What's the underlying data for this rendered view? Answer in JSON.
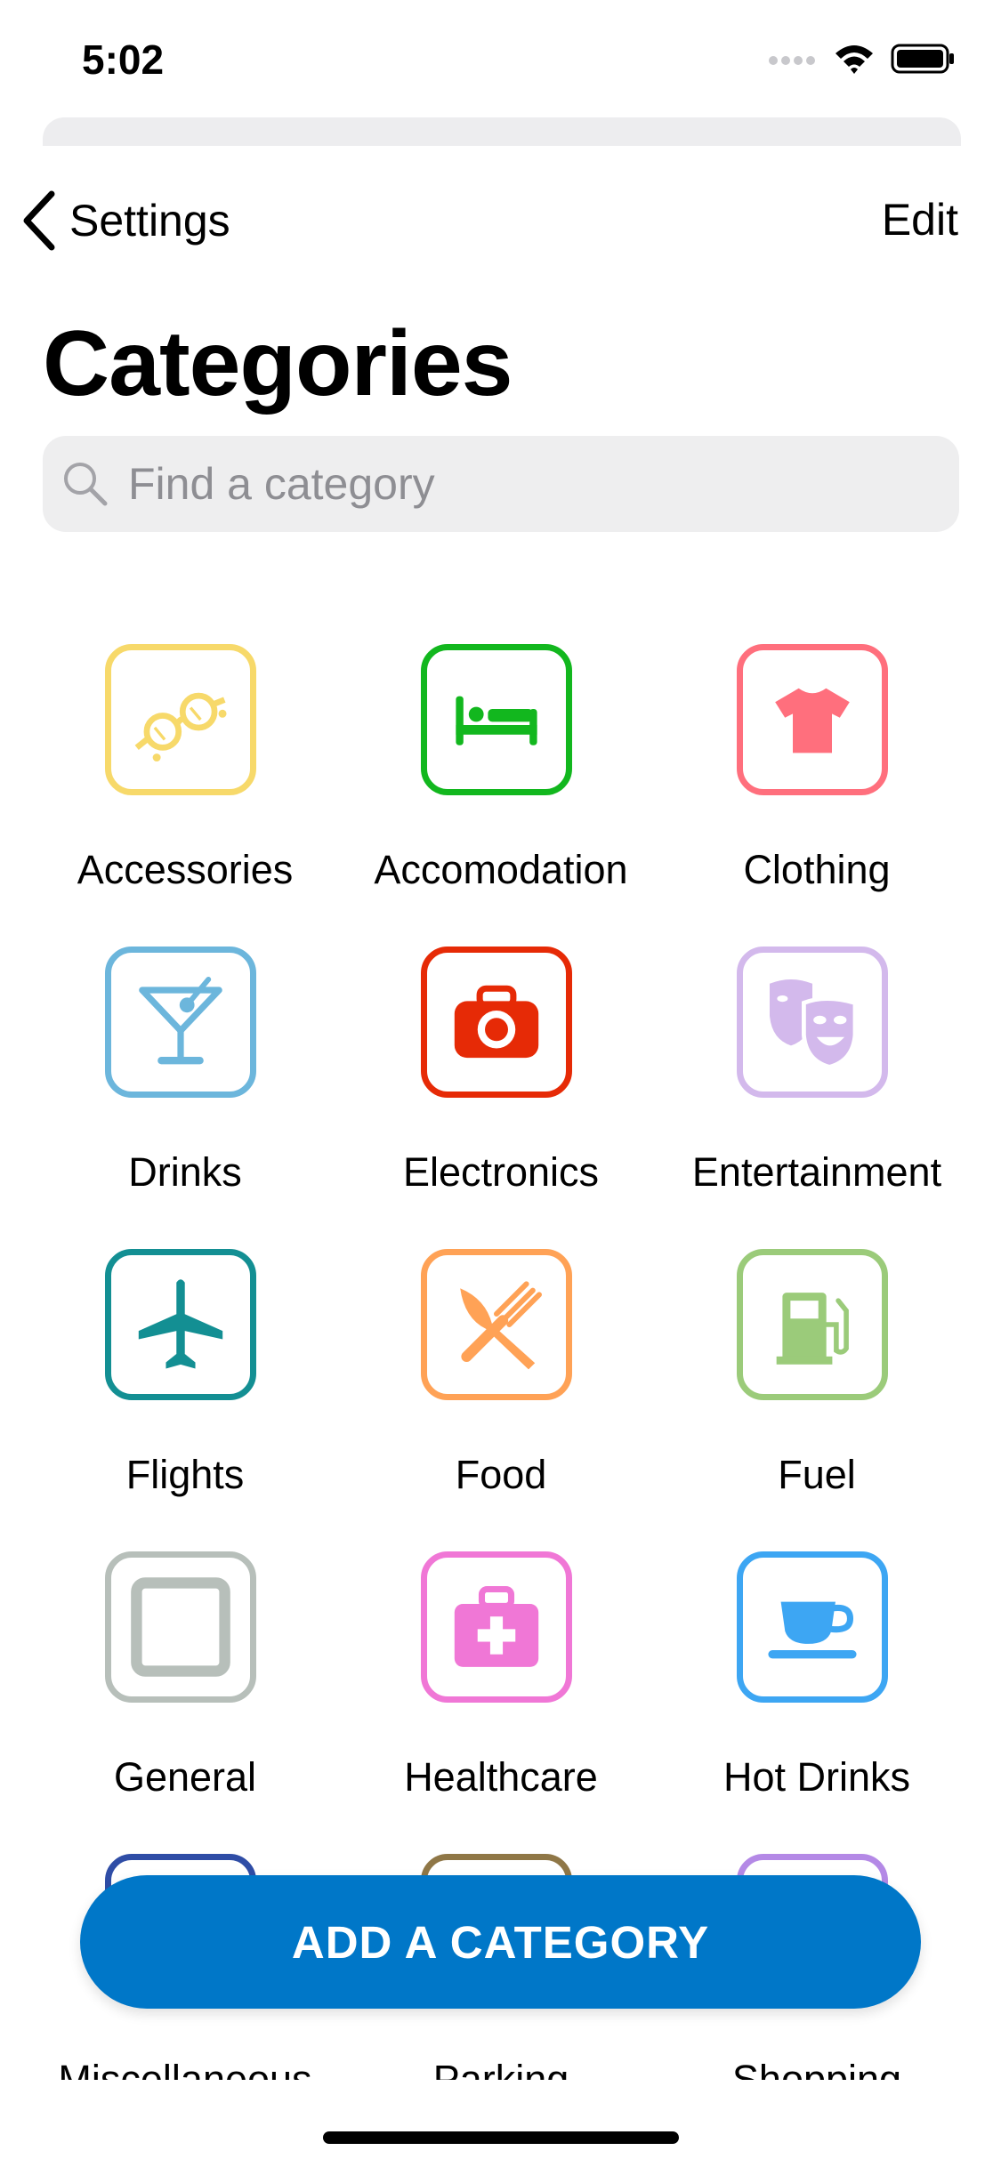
{
  "status_bar": {
    "time": "5:02"
  },
  "nav": {
    "back_label": "Settings",
    "edit_label": "Edit"
  },
  "page": {
    "title": "Categories"
  },
  "search": {
    "placeholder": "Find a category"
  },
  "categories": [
    {
      "label": "Accessories",
      "icon": "sunglasses-icon",
      "color": "#F7D96A"
    },
    {
      "label": "Accomodation",
      "icon": "bed-icon",
      "color": "#12B71E"
    },
    {
      "label": "Clothing",
      "icon": "tshirt-icon",
      "color": "#FF6F7D"
    },
    {
      "label": "Drinks",
      "icon": "cocktail-icon",
      "color": "#6CB6DC"
    },
    {
      "label": "Electronics",
      "icon": "camera-icon",
      "color": "#E62A06"
    },
    {
      "label": "Entertainment",
      "icon": "theater-masks-icon",
      "color": "#D3B9EC"
    },
    {
      "label": "Flights",
      "icon": "airplane-icon",
      "color": "#138F93"
    },
    {
      "label": "Food",
      "icon": "utensils-icon",
      "color": "#FFA256"
    },
    {
      "label": "Fuel",
      "icon": "gas-pump-icon",
      "color": "#9BCB7A"
    },
    {
      "label": "General",
      "icon": "square-icon",
      "color": "#B7BFBA"
    },
    {
      "label": "Healthcare",
      "icon": "first-aid-kit-icon",
      "color": "#F077D6"
    },
    {
      "label": "Hot Drinks",
      "icon": "coffee-cup-icon",
      "color": "#3DA6F3"
    },
    {
      "label": "Miscellaneous",
      "icon": "misc-icon",
      "color": "#2F4DA6"
    },
    {
      "label": "Parking",
      "icon": "parking-icon",
      "color": "#8F7747"
    },
    {
      "label": "Shopping",
      "icon": "shopping-icon",
      "color": "#B489E6"
    }
  ],
  "add_button": {
    "label": "ADD A CATEGORY",
    "color": "#0077C8"
  }
}
